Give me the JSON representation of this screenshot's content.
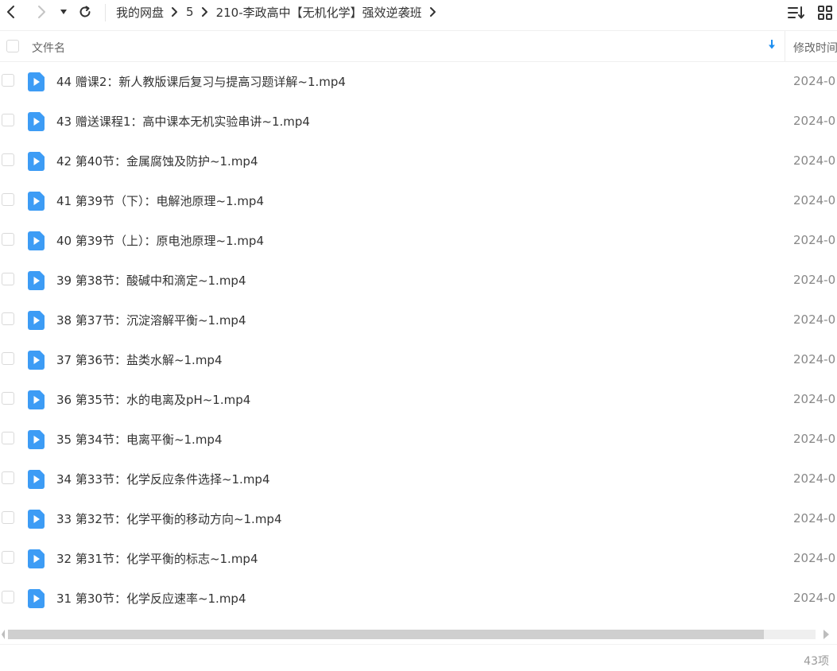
{
  "nav": {
    "back_icon": "chevron-left-icon",
    "forward_icon": "chevron-right-icon",
    "history_icon": "caret-down-icon",
    "refresh_icon": "refresh-icon"
  },
  "breadcrumb": [
    {
      "label": "我的网盘"
    },
    {
      "label": "5"
    },
    {
      "label": "210-李政高中【无机化学】强效逆袭班"
    }
  ],
  "toolbar": {
    "sort_icon": "sort-list-icon",
    "view_icon": "grid-view-icon"
  },
  "table": {
    "columns": {
      "name": "文件名",
      "mtime": "修改时间"
    },
    "rows": [
      {
        "name": "44 赠课2：新人教版课后复习与提高习题详解~1.mp4",
        "time": "2024-0"
      },
      {
        "name": "43 赠送课程1：高中课本无机实验串讲~1.mp4",
        "time": "2024-0"
      },
      {
        "name": "42 第40节：金属腐蚀及防护~1.mp4",
        "time": "2024-0"
      },
      {
        "name": "41 第39节（下）：电解池原理~1.mp4",
        "time": "2024-0"
      },
      {
        "name": "40 第39节（上）：原电池原理~1.mp4",
        "time": "2024-0"
      },
      {
        "name": "39 第38节：酸碱中和滴定~1.mp4",
        "time": "2024-0"
      },
      {
        "name": "38 第37节：沉淀溶解平衡~1.mp4",
        "time": "2024-0"
      },
      {
        "name": "37 第36节：盐类水解~1.mp4",
        "time": "2024-0"
      },
      {
        "name": "36 第35节：水的电离及pH~1.mp4",
        "time": "2024-0"
      },
      {
        "name": "35 第34节：电离平衡~1.mp4",
        "time": "2024-0"
      },
      {
        "name": "34 第33节：化学反应条件选择~1.mp4",
        "time": "2024-0"
      },
      {
        "name": "33 第32节：化学平衡的移动方向~1.mp4",
        "time": "2024-0"
      },
      {
        "name": "32 第31节：化学平衡的标志~1.mp4",
        "time": "2024-0"
      },
      {
        "name": "31 第30节：化学反应速率~1.mp4",
        "time": "2024-0"
      }
    ]
  },
  "scrollbar": {
    "position_fraction": 0.94
  },
  "footer": {
    "count": "43项"
  },
  "colors": {
    "video_icon": "#3d9cf5",
    "sort_arrow": "#1e8ff0"
  }
}
